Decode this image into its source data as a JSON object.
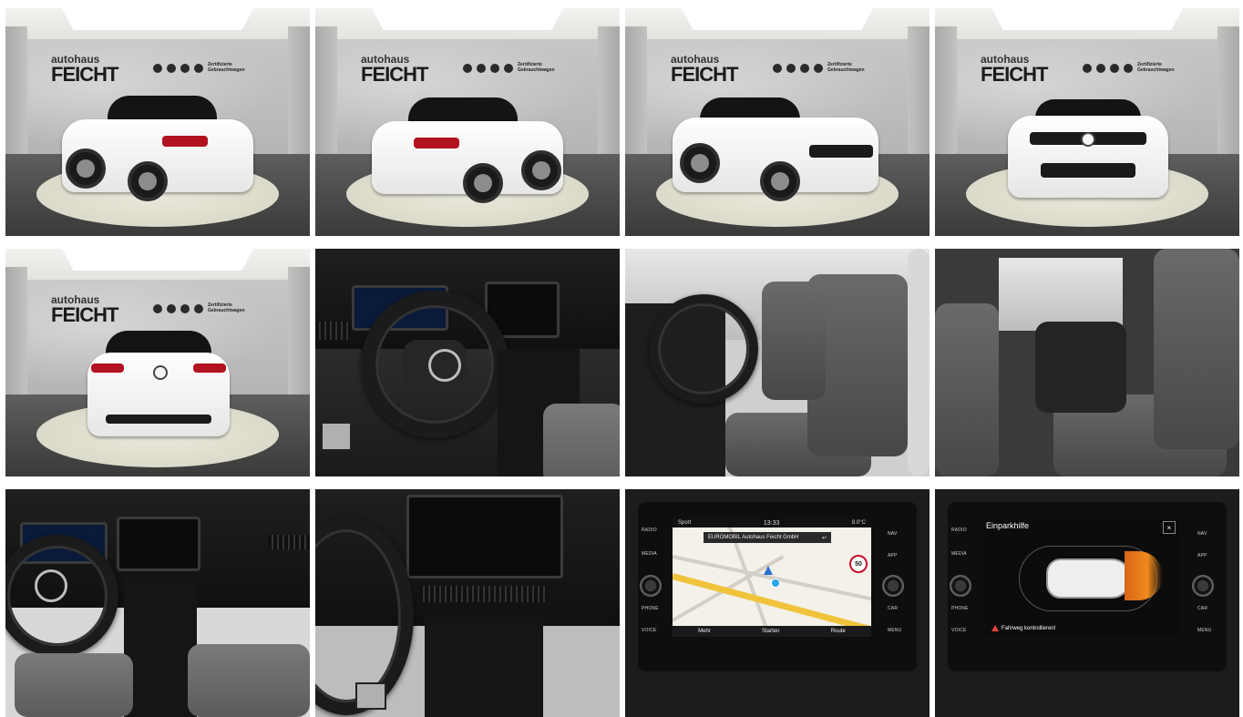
{
  "gallery": {
    "brand_small": "autohaus",
    "brand_big": "FEICHT",
    "certified_label": "Zertifizierte Gebrauchtwagen"
  },
  "nav_screen": {
    "mode": "Sport",
    "time": "13:33",
    "temperature": "8.0°C",
    "destination": "EUROMOBIL Autohaus Feicht GmbH",
    "speed_limit": "50",
    "buttons": [
      "Mehr",
      "Starten",
      "Route"
    ],
    "left_labels": [
      "RADIO",
      "MEDIA",
      "PHONE",
      "VOICE"
    ],
    "right_labels": [
      "NAV",
      "APP",
      "CAR",
      "MENU"
    ]
  },
  "park_screen": {
    "title": "Einparkhilfe",
    "close": "×",
    "warning": "Fahrweg kontrollieren!",
    "left_labels": [
      "RADIO",
      "MEDIA",
      "PHONE",
      "VOICE"
    ],
    "right_labels": [
      "NAV",
      "APP",
      "CAR",
      "MENU"
    ]
  },
  "colors": {
    "brand_red": "#c8102e",
    "lamp_red": "#b3121f",
    "park_orange": "#f08a1c",
    "route_yellow": "#f0c33b"
  }
}
